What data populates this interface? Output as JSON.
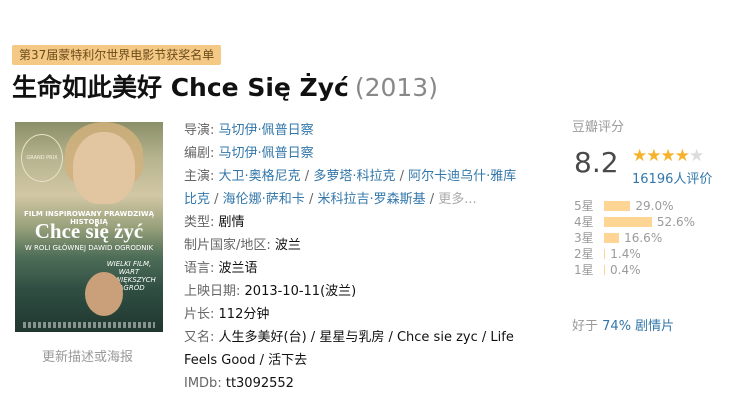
{
  "festival_badge": "第37届蒙特利尔世界电影节获奖名单",
  "title": {
    "main": "生命如此美好 Chce Się Żyć",
    "year": "(2013)"
  },
  "poster": {
    "award_text": "GRAND PRIX",
    "tagline": "FILM INSPIROWANY PRAWDZIWĄ HISTORIĄ",
    "film_title": "Chce się żyć",
    "starring": "W ROLI GŁÓWNEJ DAWID OGRODNIK",
    "quote": "WIELKI FILM, WART NAJWIĘKSZYCH NAGRÓD"
  },
  "update_link": "更新描述或海报",
  "info": {
    "director_label": "导演:",
    "director": "马切伊·佩普日察",
    "writer_label": "编剧:",
    "writer": "马切伊·佩普日察",
    "cast_label": "主演:",
    "cast": [
      "大卫·奥格尼克",
      "多萝塔·科拉克",
      "阿尔卡迪乌什·雅库比克",
      "海伦娜·萨和卡",
      "米科拉吉·罗森斯基"
    ],
    "cast_line1": [
      "大卫·奥格尼克",
      "多萝塔·科拉克",
      "阿尔卡迪乌什·雅库"
    ],
    "cast_line2_lead": "比克",
    "cast_line2": [
      "海伦娜·萨和卡",
      "米科拉吉·罗森斯基"
    ],
    "more": "更多...",
    "genre_label": "类型:",
    "genre": "剧情",
    "country_label": "制片国家/地区:",
    "country": "波兰",
    "language_label": "语言:",
    "language": "波兰语",
    "release_label": "上映日期:",
    "release": "2013-10-11(波兰)",
    "runtime_label": "片长:",
    "runtime": "112分钟",
    "aka_label": "又名:",
    "aka_line1": "人生多美好(台) / 星星与乳房 / Chce sie zyc / Life",
    "aka_line2": "Feels Good / 活下去",
    "imdb_label": "IMDb:",
    "imdb": "tt3092552"
  },
  "rating": {
    "label": "豆瓣评分",
    "score": "8.2",
    "stars_on": 4,
    "stars_total": 5,
    "votes": "16196人评价",
    "distribution": [
      {
        "label": "5星",
        "percent": 29.0,
        "text": "29.0%"
      },
      {
        "label": "4星",
        "percent": 52.6,
        "text": "52.6%"
      },
      {
        "label": "3星",
        "percent": 16.6,
        "text": "16.6%"
      },
      {
        "label": "2星",
        "percent": 1.4,
        "text": "1.4%"
      },
      {
        "label": "1星",
        "percent": 0.4,
        "text": "0.4%"
      }
    ]
  },
  "better_than": {
    "prefix": "好于",
    "highlight": "74% 剧情片"
  },
  "colors": {
    "link": "#3377aa",
    "badge_bg": "#f4c985",
    "star": "#f7b22b",
    "bar": "#ffd596"
  }
}
